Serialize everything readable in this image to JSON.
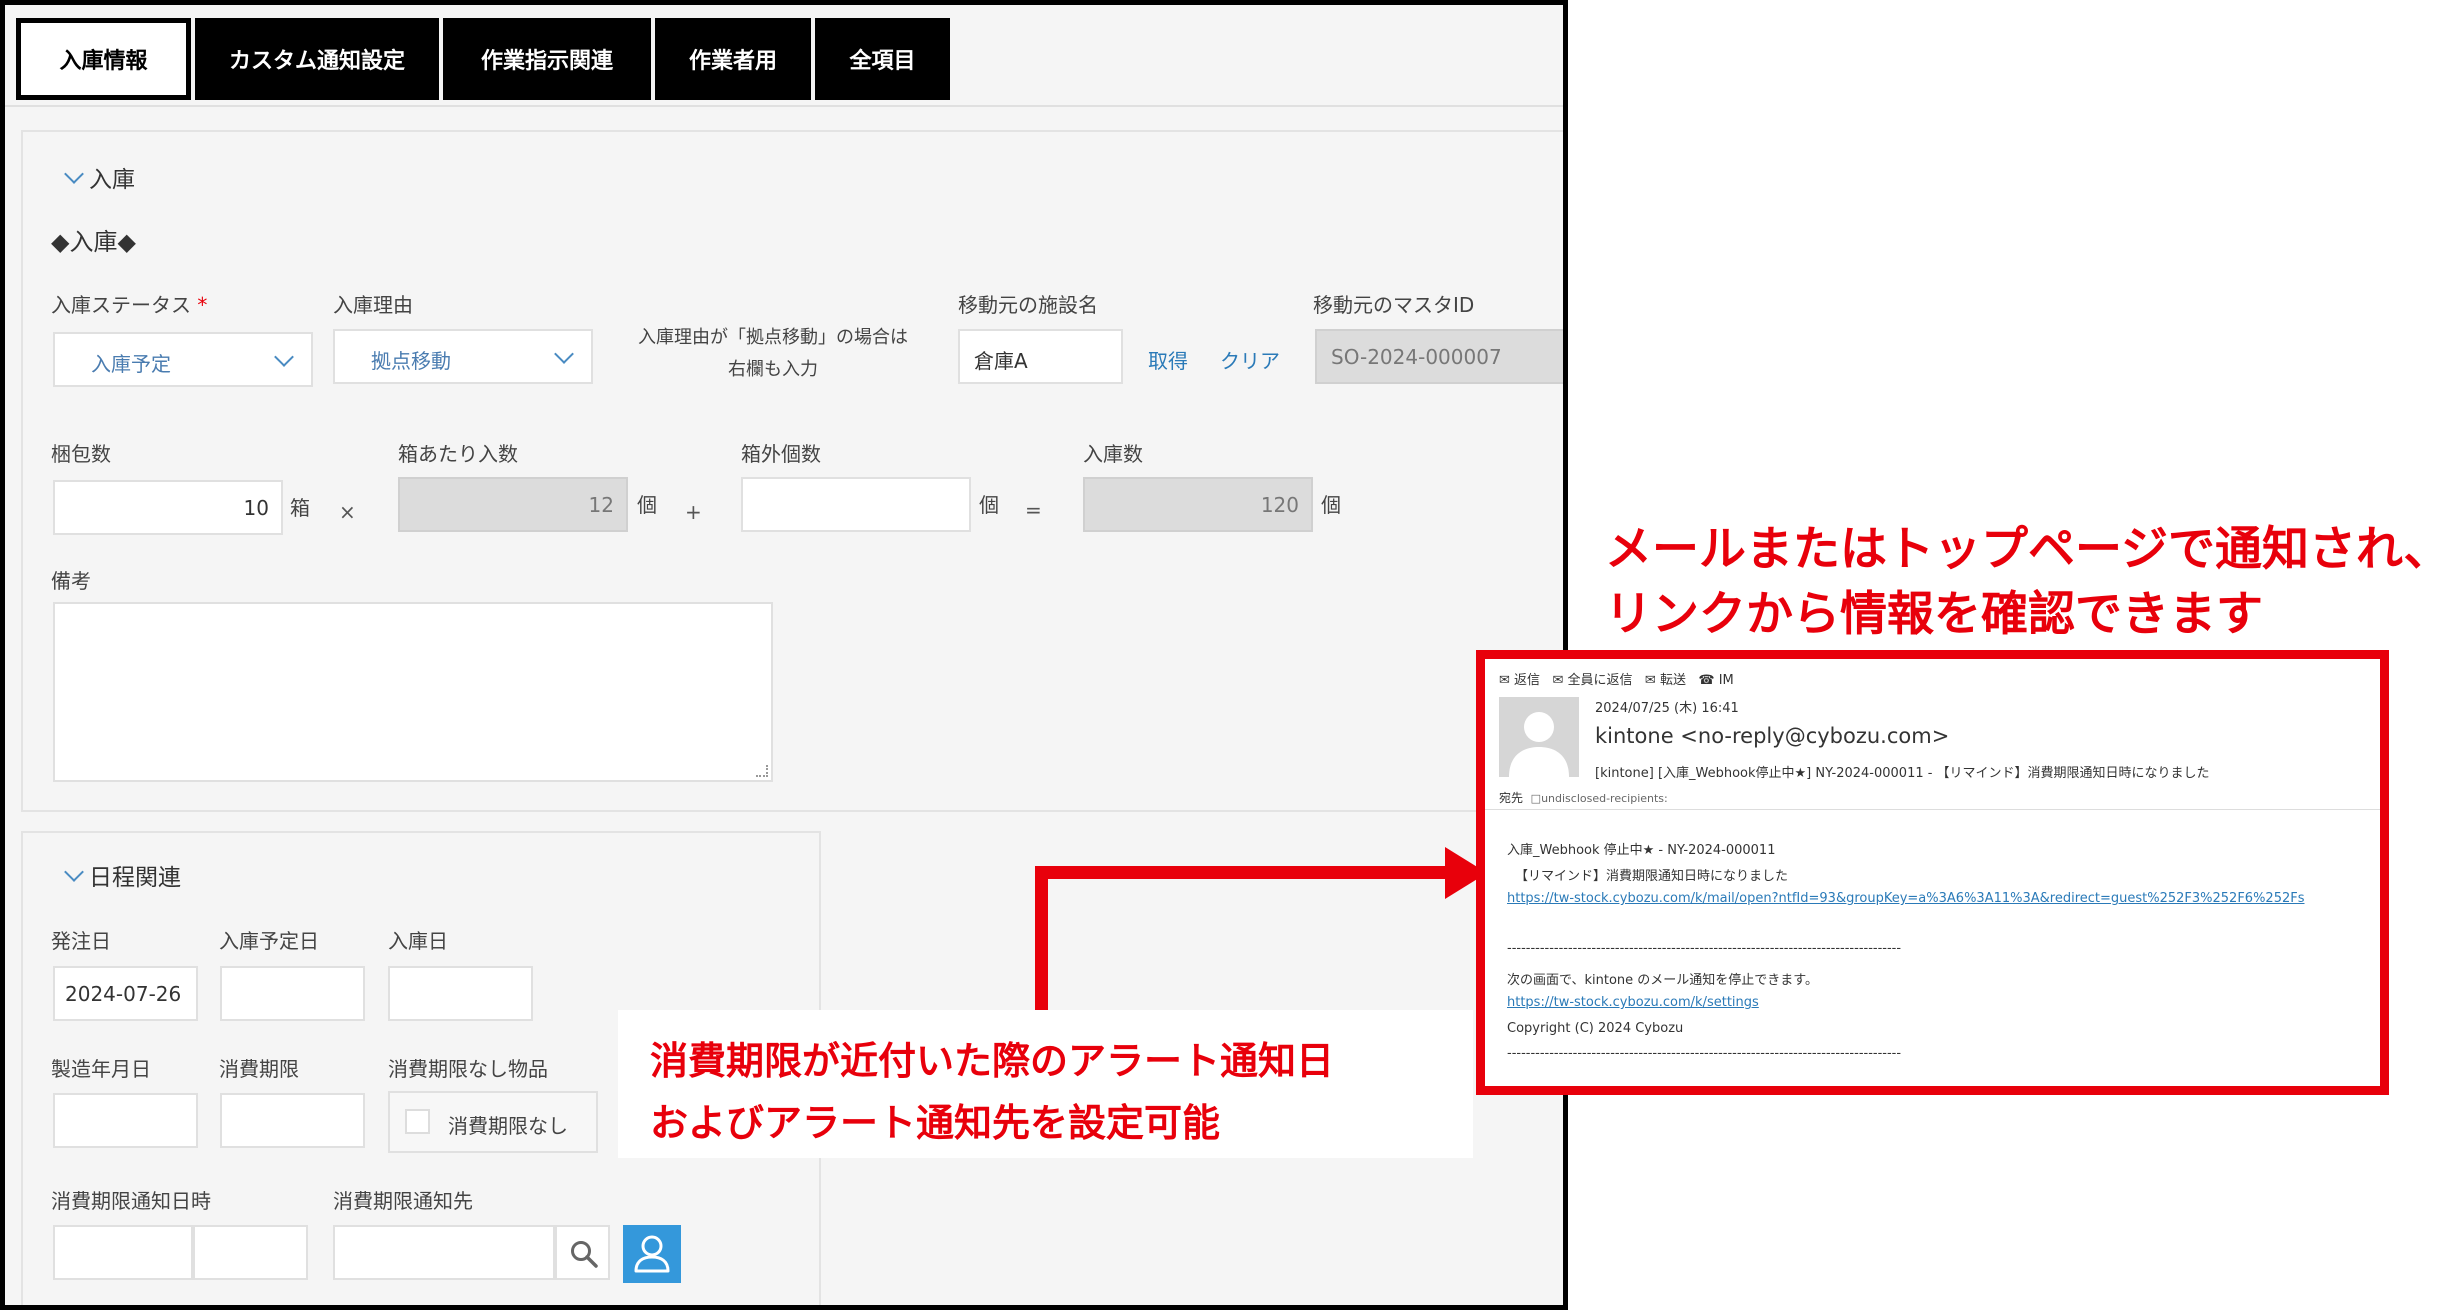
{
  "tabs": [
    "入庫情報",
    "カスタム通知設定",
    "作業指示関連",
    "作業者用",
    "全項目"
  ],
  "section1": {
    "header": "入庫",
    "subheader": "◆入庫◆",
    "status_label": "入庫ステータス",
    "required_mark": "*",
    "status_value": "入庫予定",
    "reason_label": "入庫理由",
    "reason_value": "拠点移動",
    "reason_note_line1": "入庫理由が「拠点移動」の場合は",
    "reason_note_line2": "右欄も入力",
    "facility_label": "移動元の施設名",
    "facility_value": "倉庫A",
    "get_link": "取得",
    "clear_link": "クリア",
    "master_label": "移動元のマスタID",
    "master_value": "SO-2024-000007",
    "pack_label": "梱包数",
    "pack_value": "10",
    "pack_unit": "箱",
    "op_times": "×",
    "per_box_label": "箱あたり入数",
    "per_box_value": "12",
    "per_box_unit": "個",
    "op_plus": "+",
    "outside_label": "箱外個数",
    "outside_value": "",
    "outside_unit": "個",
    "op_eq": "=",
    "total_label": "入庫数",
    "total_value": "120",
    "total_unit": "個",
    "note_label": "備考"
  },
  "section2": {
    "header": "日程関連",
    "order_date_label": "発注日",
    "order_date_value": "2024-07-26",
    "planned_label": "入庫予定日",
    "received_label": "入庫日",
    "mfg_label": "製造年月日",
    "expiry_label": "消費期限",
    "no_expiry_label": "消費期限なし物品",
    "no_expiry_checkbox": "消費期限なし",
    "notify_dt_label": "消費期限通知日時",
    "notify_to_label": "消費期限通知先"
  },
  "callouts": {
    "top_line1": "メールまたはトップページで通知され、",
    "top_line2": "リンクから情報を確認できます",
    "bottom_line1": "消費期限が近付いた際のアラート通知日",
    "bottom_line2": "およびアラート通知先を設定可能"
  },
  "mail": {
    "toolbar": [
      "返信",
      "全員に返信",
      "転送",
      "IM"
    ],
    "datetime": "2024/07/25 (木) 16:41",
    "sender": "kintone <no-reply@cybozu.com>",
    "subject": "[kintone] [入庫_Webhook停止中★] NY-2024-000011 - 【リマインド】消費期限通知日時になりました",
    "to_label": "宛先",
    "to_value": "undisclosed-recipients:",
    "body_line1": "入庫_Webhook 停止中★ - NY-2024-000011",
    "body_line2": "【リマインド】消費期限通知日時になりました",
    "body_link1": "https://tw-stock.cybozu.com/k/mail/open?ntfId=93&groupKey=a%3A6%3A11%3A&redirect=guest%252F3%252F6%252Fs",
    "separator": "------------------------------------------------------------------------------------",
    "body_line3": "次の画面で、kintone のメール通知を停止できます。",
    "body_link2": "https://tw-stock.cybozu.com/k/settings",
    "copyright": "Copyright (C) 2024 Cybozu"
  },
  "colors": {
    "accent_red": "#e8000b",
    "link_blue": "#2a7ab8",
    "user_button": "#3498db"
  }
}
